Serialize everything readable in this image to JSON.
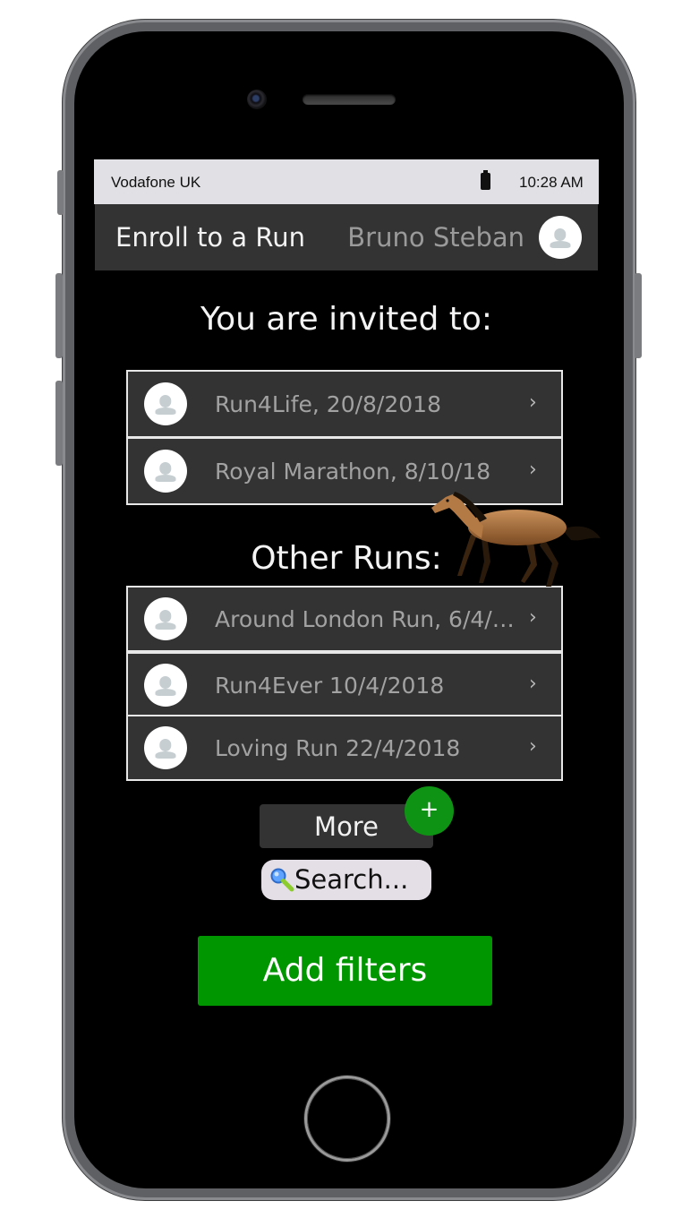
{
  "status_bar": {
    "carrier": "Vodafone UK",
    "time": "10:28 AM"
  },
  "header": {
    "title": "Enroll to a Run",
    "user_name": "Bruno Steban"
  },
  "invited_section": {
    "title": "You are invited to:",
    "runs": [
      {
        "label": "Run4Life, 20/8/2018",
        "chevron": "›"
      },
      {
        "label": "Royal Marathon, 8/10/18",
        "chevron": "›"
      }
    ]
  },
  "other_section": {
    "title": "Other Runs:",
    "runs": [
      {
        "label": "Around London Run, 6/4/2...",
        "chevron": "›"
      },
      {
        "label": "Run4Ever 10/4/2018",
        "chevron": "›"
      },
      {
        "label": "Loving Run 22/4/2018",
        "chevron": "›"
      }
    ]
  },
  "actions": {
    "more_label": "More",
    "plus_label": "+",
    "search_text": "Search...",
    "filters_label": "Add filters"
  },
  "colors": {
    "accent_green": "#009600",
    "plus_green": "#0f9314",
    "row_background": "#333333"
  },
  "icons": [
    "camera-icon",
    "battery-icon",
    "user-avatar-icon",
    "chevron-right-icon",
    "magnifier-icon",
    "horse-image"
  ]
}
